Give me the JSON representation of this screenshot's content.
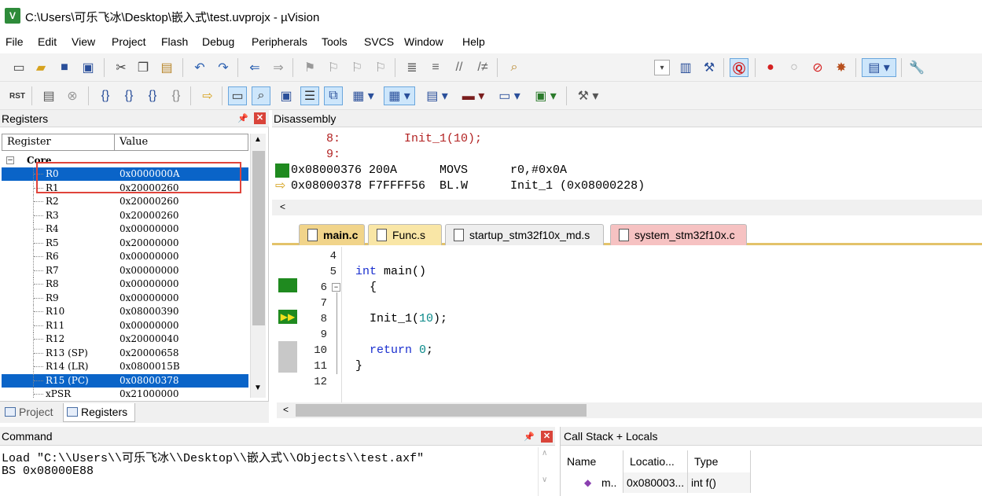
{
  "window": {
    "title": "C:\\Users\\可乐飞冰\\Desktop\\嵌入式\\test.uvprojx - µVision",
    "app_icon": "V"
  },
  "menu": [
    "File",
    "Edit",
    "View",
    "Project",
    "Flash",
    "Debug",
    "Peripherals",
    "Tools",
    "SVCS",
    "Window",
    "Help"
  ],
  "toolbar1_icons": [
    "new-file-icon",
    "open-folder-icon",
    "save-icon",
    "save-all-icon",
    "cut-icon",
    "copy-icon",
    "paste-icon",
    "undo-icon",
    "redo-icon",
    "nav-back-icon",
    "nav-forward-icon",
    "bookmark-icon",
    "bookmark-prev-icon",
    "bookmark-next-icon",
    "bookmark-clear-icon",
    "indent-icon",
    "unindent-icon",
    "comment-icon",
    "uncomment-icon",
    "find-in-files-icon",
    "target-dropdown-icon",
    "options-icon",
    "manage-icon",
    "debug-session-icon",
    "breakpoint-icon",
    "disable-breakpoint-icon",
    "clear-breakpoints-icon",
    "kill-breakpoints-icon",
    "window-layout-icon",
    "settings-icon"
  ],
  "toolbar2_icons": [
    "reset-icon",
    "run-icon",
    "stop-icon",
    "step-into-icon",
    "step-over-icon",
    "step-out-icon",
    "run-to-cursor-icon",
    "show-next-statement-icon",
    "command-window-icon",
    "disassembly-window-icon",
    "symbols-window-icon",
    "registers-window-icon",
    "call-stack-window-icon",
    "watch-window-icon",
    "memory-window-icon",
    "serial-window-icon",
    "analysis-window-icon",
    "trace-window-icon",
    "system-viewer-icon",
    "toolbox-icon"
  ],
  "registers": {
    "title": "Registers",
    "col_register": "Register",
    "col_value": "Value",
    "group": "Core",
    "rows": [
      {
        "name": "R0",
        "value": "0x0000000A",
        "selected": true
      },
      {
        "name": "R1",
        "value": "0x20000260",
        "selected": false
      },
      {
        "name": "R2",
        "value": "0x20000260",
        "selected": false
      },
      {
        "name": "R3",
        "value": "0x20000260",
        "selected": false
      },
      {
        "name": "R4",
        "value": "0x00000000",
        "selected": false
      },
      {
        "name": "R5",
        "value": "0x20000000",
        "selected": false
      },
      {
        "name": "R6",
        "value": "0x00000000",
        "selected": false
      },
      {
        "name": "R7",
        "value": "0x00000000",
        "selected": false
      },
      {
        "name": "R8",
        "value": "0x00000000",
        "selected": false
      },
      {
        "name": "R9",
        "value": "0x00000000",
        "selected": false
      },
      {
        "name": "R10",
        "value": "0x08000390",
        "selected": false
      },
      {
        "name": "R11",
        "value": "0x00000000",
        "selected": false
      },
      {
        "name": "R12",
        "value": "0x20000040",
        "selected": false
      },
      {
        "name": "R13 (SP)",
        "value": "0x20000658",
        "selected": false
      },
      {
        "name": "R14 (LR)",
        "value": "0x0800015B",
        "selected": false
      },
      {
        "name": "R15 (PC)",
        "value": "0x08000378",
        "selected": true
      },
      {
        "name": "xPSR",
        "value": "0x21000000",
        "selected": false
      }
    ],
    "tab_project": "Project",
    "tab_registers": "Registers"
  },
  "disassembly": {
    "title": "Disassembly",
    "lines": [
      {
        "text": "     8:         Init_1(10);",
        "type": "source"
      },
      {
        "text": "     9:",
        "type": "source"
      },
      {
        "text": "0x08000376 200A      MOVS      r0,#0x0A",
        "type": "asm"
      },
      {
        "text": "0x08000378 F7FFFF56  BL.W      Init_1 (0x08000228)",
        "type": "asm"
      }
    ]
  },
  "editor": {
    "tabs": [
      "main.c",
      "Func.s",
      "startup_stm32f10x_md.s",
      "system_stm32f10x.c"
    ],
    "active_tab": "main.c",
    "line_numbers": [
      "4",
      "5",
      "6",
      "7",
      "8",
      "9",
      "10",
      "11",
      "12"
    ],
    "code": {
      "l5_kw": "int",
      "l5_rest": " main()",
      "l6": "  {",
      "l8_a": "  Init_1(",
      "l8_num": "10",
      "l8_b": ");",
      "l10_kw": "  return",
      "l10_sp": " ",
      "l10_num": "0",
      "l10_semi": ";",
      "l11": "}"
    }
  },
  "command": {
    "title": "Command",
    "lines": [
      "Load \"C:\\\\Users\\\\可乐飞冰\\\\Desktop\\\\嵌入式\\\\Objects\\\\test.axf\"",
      "BS 0x08000E88"
    ]
  },
  "callstack": {
    "title": "Call Stack + Locals",
    "col_name": "Name",
    "col_location": "Locatio...",
    "col_type": "Type",
    "row": {
      "name": "m..",
      "location": "0x080003...",
      "type": "int f()"
    }
  },
  "colors": {
    "selection": "#0a64c8",
    "highlight_box": "#e0443b",
    "source_text": "#b22222",
    "exec_green": "#1f8a1f"
  }
}
